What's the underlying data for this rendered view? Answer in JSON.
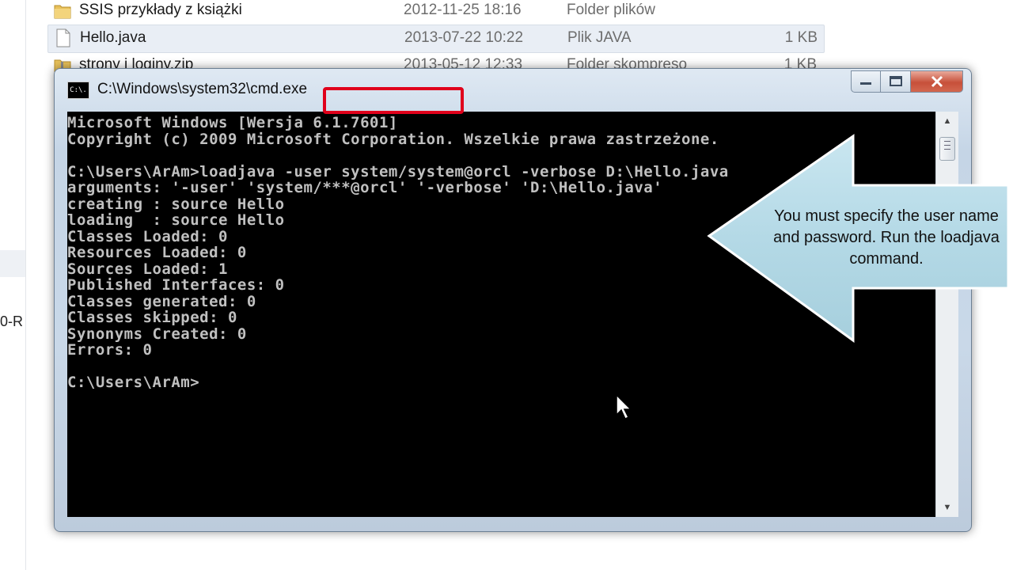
{
  "explorer": {
    "left_pane_text": "0-R",
    "files": [
      {
        "name": "SSIS przykłady z książki",
        "date": "2012-11-25 18:16",
        "type": "Folder plików",
        "size": "",
        "icon": "folder-icon"
      },
      {
        "name": "Hello.java",
        "date": "2013-07-22 10:22",
        "type": "Plik JAVA",
        "size": "1 KB",
        "icon": "file-icon"
      },
      {
        "name": "strony i loginy.zip",
        "date": "2013-05-12 12:33",
        "type": "Folder skompreso",
        "size": "1 KB",
        "icon": "zip-folder-icon"
      }
    ]
  },
  "cmd": {
    "title": "C:\\Windows\\system32\\cmd.exe",
    "icon_text": "C:\\.",
    "controls": {
      "minimize": "minimize-icon",
      "maximize": "maximize-icon",
      "close": "close-icon"
    },
    "lines": [
      "Microsoft Windows [Wersja 6.1.7601]",
      "Copyright (c) 2009 Microsoft Corporation. Wszelkie prawa zastrzeżone.",
      "",
      "C:\\Users\\ArAm>loadjava -user system/system@orcl -verbose D:\\Hello.java",
      "arguments: '-user' 'system/***@orcl' '-verbose' 'D:\\Hello.java'",
      "creating : source Hello",
      "loading  : source Hello",
      "Classes Loaded: 0",
      "Resources Loaded: 0",
      "Sources Loaded: 1",
      "Published Interfaces: 0",
      "Classes generated: 0",
      "Classes skipped: 0",
      "Synonyms Created: 0",
      "Errors: 0",
      "",
      "C:\\Users\\ArAm>"
    ]
  },
  "callout": {
    "text": "You must specify the user name and password. Run the loadjava command."
  },
  "colors": {
    "highlight": "#e0001b",
    "console_bg": "#000000",
    "console_fg": "#c0c0c0",
    "callout_fill": "#b8dce8"
  }
}
